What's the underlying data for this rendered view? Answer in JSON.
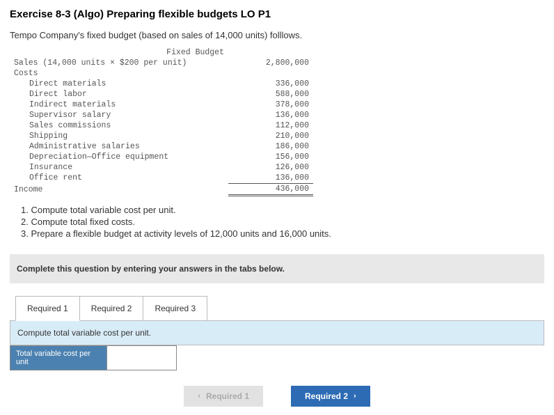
{
  "title": "Exercise 8-3 (Algo) Preparing flexible budgets LO P1",
  "intro": "Tempo Company's fixed budget (based on sales of 14,000 units) folllows.",
  "budget": {
    "header": "Fixed Budget",
    "sales_label": "Sales (14,000 units × $200 per unit)",
    "sales_val": "2,800,000",
    "costs_label": "Costs",
    "rows": [
      {
        "label": "Direct materials",
        "val": "336,000"
      },
      {
        "label": "Direct labor",
        "val": "588,000"
      },
      {
        "label": "Indirect materials",
        "val": "378,000"
      },
      {
        "label": "Supervisor salary",
        "val": "136,000"
      },
      {
        "label": "Sales commissions",
        "val": "112,000"
      },
      {
        "label": "Shipping",
        "val": "210,000"
      },
      {
        "label": "Administrative salaries",
        "val": "186,000"
      },
      {
        "label": "Depreciation—Office equipment",
        "val": "156,000"
      },
      {
        "label": "Insurance",
        "val": "126,000"
      },
      {
        "label": "Office rent",
        "val": "136,000"
      }
    ],
    "income_label": "Income",
    "income_val": "436,000"
  },
  "instructions": [
    "1. Compute total variable cost per unit.",
    "2. Compute total fixed costs.",
    "3. Prepare a flexible budget at activity levels of 12,000 units and 16,000 units."
  ],
  "complete_text": "Complete this question by entering your answers in the tabs below.",
  "tabs": [
    "Required 1",
    "Required 2",
    "Required 3"
  ],
  "tab_prompt": "Compute total variable cost per unit.",
  "answer_label": "Total variable cost per unit",
  "nav": {
    "prev": "Required 1",
    "next": "Required 2"
  }
}
